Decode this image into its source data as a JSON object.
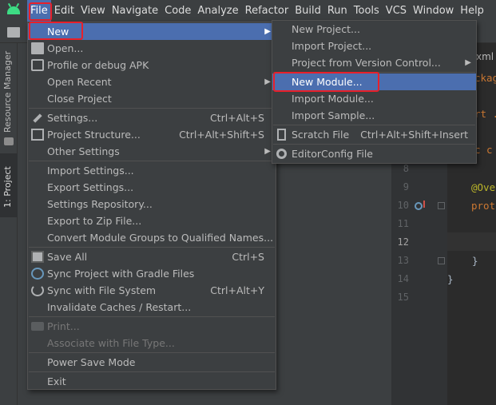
{
  "menubar": {
    "items": [
      "File",
      "Edit",
      "View",
      "Navigate",
      "Code",
      "Analyze",
      "Refactor",
      "Build",
      "Run",
      "Tools",
      "VCS",
      "Window",
      "Help"
    ]
  },
  "side_tabs": {
    "resource_manager": "Resource Manager",
    "project": "1: Project"
  },
  "editor": {
    "line_numbers": [
      "8",
      "9",
      "10",
      "11",
      "12",
      "13",
      "14",
      "15"
    ],
    "code_fragments": {
      "line1": "ckage",
      "line2": "rt .",
      "line3": "c c",
      "override": "@Ove",
      "prot": "prot",
      "brace_close_inner": "}",
      "brace_close_outer": "}",
      "tab_fragment": "xml"
    }
  },
  "file_menu": {
    "new": "New",
    "open": "Open...",
    "profile": "Profile or debug APK",
    "open_recent": "Open Recent",
    "close_project": "Close Project",
    "settings": "Settings...",
    "settings_shortcut": "Ctrl+Alt+S",
    "project_structure": "Project Structure...",
    "project_structure_shortcut": "Ctrl+Alt+Shift+S",
    "other_settings": "Other Settings",
    "import_settings": "Import Settings...",
    "export_settings": "Export Settings...",
    "settings_repository": "Settings Repository...",
    "export_zip": "Export to Zip File...",
    "convert_module": "Convert Module Groups to Qualified Names...",
    "save_all": "Save All",
    "save_all_shortcut": "Ctrl+S",
    "sync_gradle": "Sync Project with Gradle Files",
    "sync_fs": "Sync with File System",
    "sync_fs_shortcut": "Ctrl+Alt+Y",
    "invalidate": "Invalidate Caches / Restart...",
    "print": "Print...",
    "associate": "Associate with File Type...",
    "power_save": "Power Save Mode",
    "exit": "Exit"
  },
  "new_menu": {
    "new_project": "New Project...",
    "import_project": "Import Project...",
    "project_vcs": "Project from Version Control...",
    "new_module": "New Module...",
    "import_module": "Import Module...",
    "import_sample": "Import Sample...",
    "scratch_file": "Scratch File",
    "scratch_shortcut": "Ctrl+Alt+Shift+Insert",
    "editorconfig": "EditorConfig File"
  },
  "colors": {
    "menu_bg": "#3c3f41",
    "highlight": "#4b6eaf",
    "callout": "#e8202a"
  }
}
